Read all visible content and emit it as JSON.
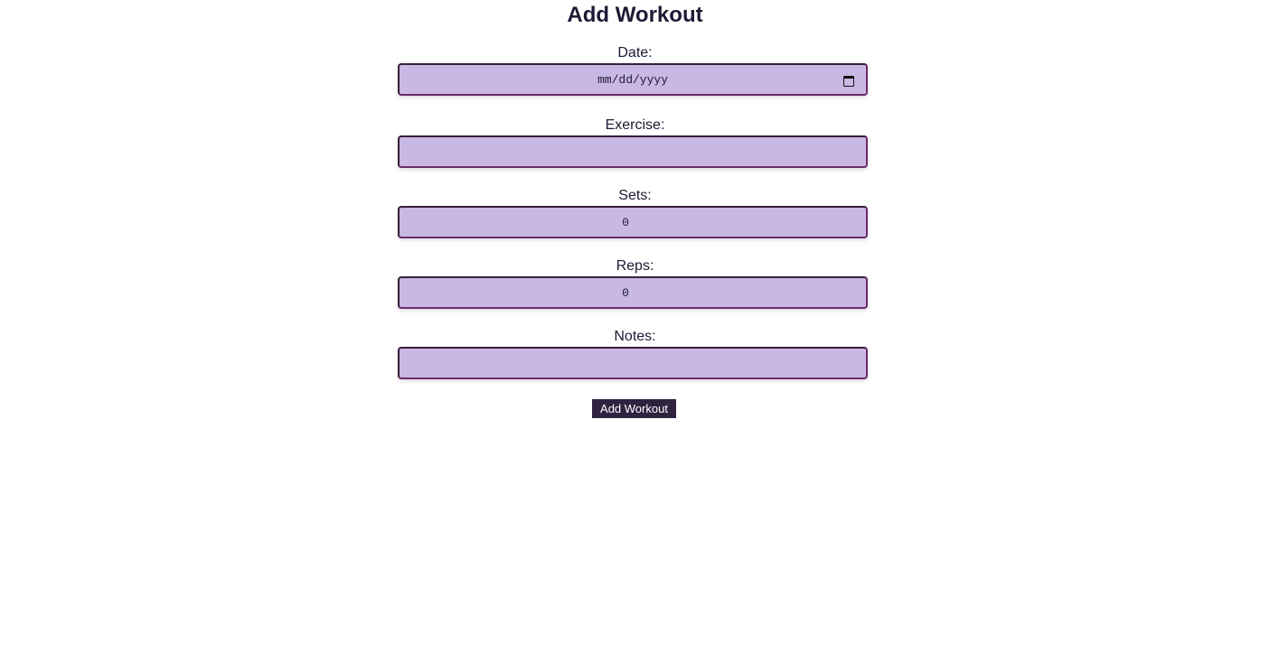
{
  "form": {
    "title": "Add Workout",
    "fields": {
      "date": {
        "label": "Date:",
        "value": "mm/dd/yyyy",
        "icon": "calendar-icon"
      },
      "exercise": {
        "label": "Exercise:",
        "value": ""
      },
      "sets": {
        "label": "Sets:",
        "value": "0"
      },
      "reps": {
        "label": "Reps:",
        "value": "0"
      },
      "notes": {
        "label": "Notes:",
        "value": ""
      }
    },
    "submit_label": "Add Workout"
  },
  "colors": {
    "field_background": "#c9b8e3",
    "field_border": "#3a1e3c",
    "button_background": "#2f2340",
    "text": "#1c1a33"
  }
}
